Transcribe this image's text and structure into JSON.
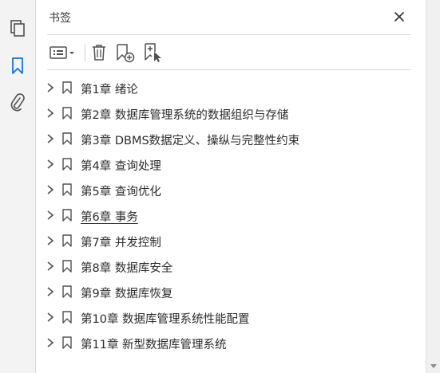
{
  "panel": {
    "title": "书签"
  },
  "sidebar": {
    "buttons": [
      {
        "icon": "pages-icon"
      },
      {
        "icon": "bookmark-icon",
        "active": true
      },
      {
        "icon": "paperclip-icon"
      }
    ]
  },
  "toolbar": {
    "buttons": [
      {
        "icon": "options-menu-icon"
      },
      {
        "icon": "trash-icon"
      },
      {
        "icon": "new-bookmark-icon"
      },
      {
        "icon": "bookmark-from-selection-icon"
      }
    ]
  },
  "bookmarks": [
    {
      "label": "第1章  绪论"
    },
    {
      "label": "第2章  数据库管理系统的数据组织与存储"
    },
    {
      "label": "第3章  DBMS数据定义、操纵与完整性约束"
    },
    {
      "label": "第4章  查询处理"
    },
    {
      "label": "第5章  查询优化"
    },
    {
      "label": "第6章  事务",
      "hovered": true
    },
    {
      "label": "第7章  并发控制"
    },
    {
      "label": "第8章  数据库安全"
    },
    {
      "label": "第9章  数据库恢复"
    },
    {
      "label": "第10章  数据库管理系统性能配置"
    },
    {
      "label": "第11章  新型数据库管理系统"
    }
  ],
  "colors": {
    "accent": "#1473e6",
    "icon": "#505050",
    "text": "#2b2b2b"
  }
}
